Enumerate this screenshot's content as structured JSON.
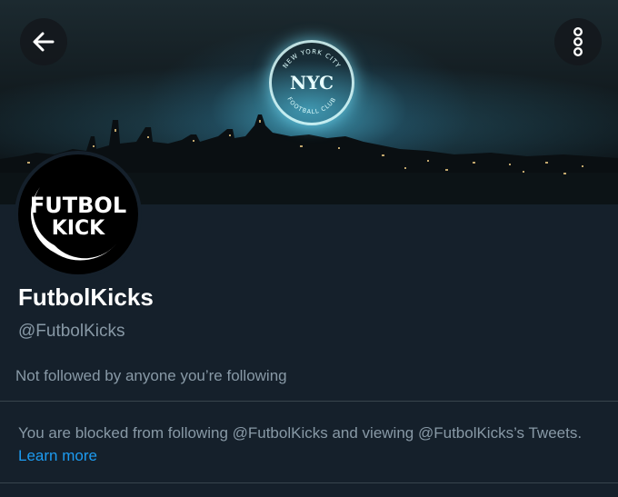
{
  "header": {
    "back_icon": "arrow-left-icon",
    "more_icon": "vertical-dots-icon",
    "banner_text_top": "NEW YORK CITY",
    "banner_text_bottom": "FOOTBALL CLUB",
    "banner_monogram": "NYC"
  },
  "profile": {
    "avatar_line1": "FUTBOL",
    "avatar_line2": "KICK",
    "display_name": "FutbolKicks",
    "handle": "@FutbolKicks",
    "followed_by": "Not followed by anyone you’re following"
  },
  "blocked_notice": {
    "text": "You are blocked from following @FutbolKicks and viewing @FutbolKicks’s Tweets.",
    "link": "Learn more"
  },
  "colors": {
    "background": "#15202b",
    "secondary_text": "#8899a6",
    "link": "#1d9bf0",
    "divider": "#38444d"
  }
}
